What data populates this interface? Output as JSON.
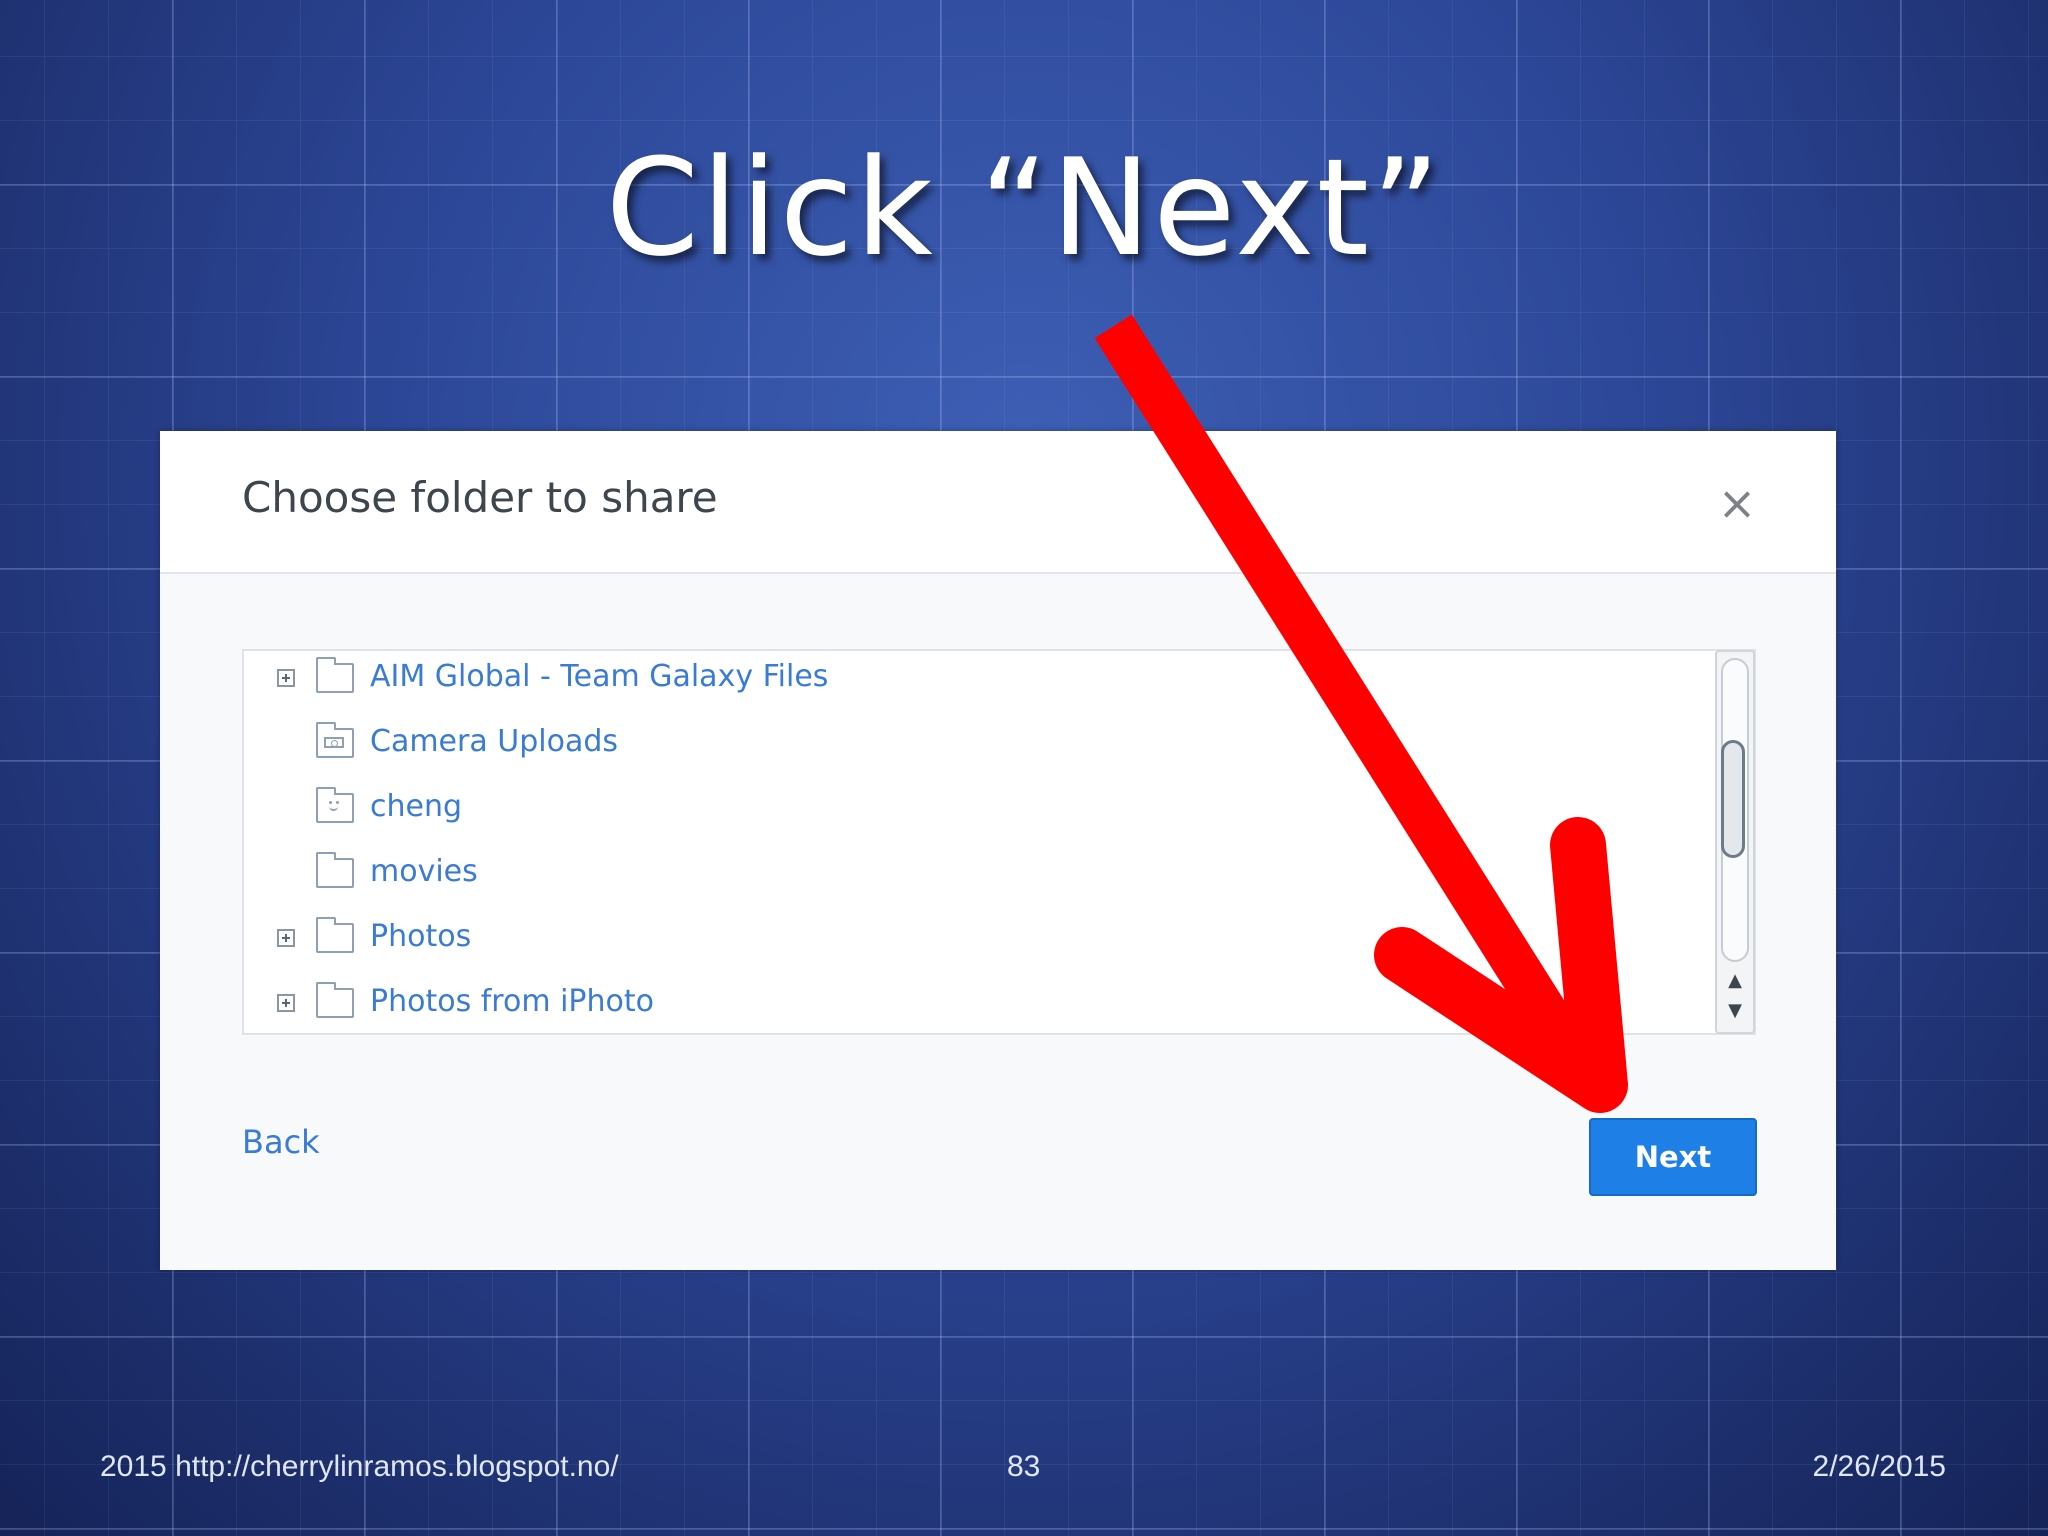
{
  "slide": {
    "title": "Click “Next”"
  },
  "dialog": {
    "title": "Choose folder to share",
    "close_icon": "×",
    "folders": [
      {
        "label": "AIM Global - Team Galaxy Files",
        "expandable": true,
        "icon": "folder-icon"
      },
      {
        "label": "Camera Uploads",
        "expandable": false,
        "icon": "camera-folder-icon"
      },
      {
        "label": "cheng",
        "expandable": false,
        "icon": "shared-folder-icon"
      },
      {
        "label": "movies",
        "expandable": false,
        "icon": "folder-icon"
      },
      {
        "label": "Photos",
        "expandable": true,
        "icon": "folder-icon"
      },
      {
        "label": "Photos from iPhoto",
        "expandable": true,
        "icon": "folder-icon"
      }
    ],
    "scroll_up_glyph": "▲",
    "scroll_down_glyph": "▼",
    "back_label": "Back",
    "next_label": "Next"
  },
  "annotation": {
    "arrow_color": "#ff0000"
  },
  "footer": {
    "left": "2015 http://cherrylinramos.blogspot.no/",
    "page_number": "83",
    "date": "2/26/2015"
  },
  "colors": {
    "next_button": "#1e7fe6",
    "link": "#3a7bd5"
  }
}
